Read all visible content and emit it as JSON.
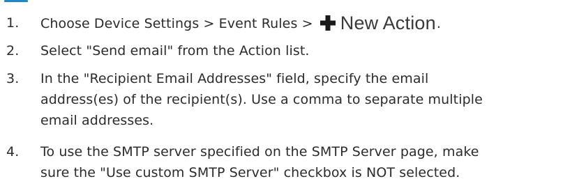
{
  "steps": [
    {
      "number": "1.",
      "text_before": "Choose Device Settings > Event Rules >",
      "button": {
        "icon": "plus-icon",
        "label": "New Action"
      },
      "text_after": "."
    },
    {
      "number": "2.",
      "text": "Select \"Send email\" from the Action list."
    },
    {
      "number": "3.",
      "lines": [
        "In the \"Recipient Email Addresses\" field, specify the email",
        "address(es) of the recipient(s). Use a comma to separate multiple",
        "email addresses."
      ]
    },
    {
      "number": "4.",
      "lines": [
        "To use the SMTP server specified on the SMTP Server page, make",
        "sure the \"Use custom SMTP Server\" checkbox is NOT selected."
      ]
    }
  ],
  "colors": {
    "text": "#2b2b2b",
    "heading_accent": "#1e88c8",
    "icon": "#1a1a1a"
  }
}
